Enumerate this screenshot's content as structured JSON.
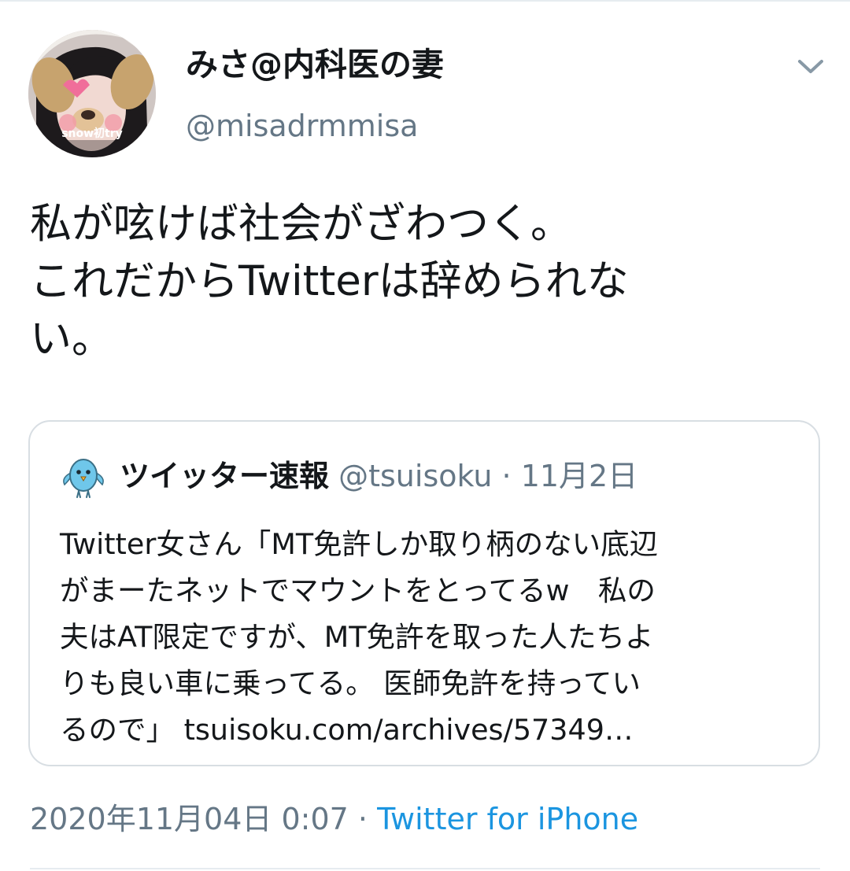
{
  "tweet": {
    "display_name": "みさ@内科医の妻",
    "handle": "@misadrmmisa",
    "avatar_icon": "user-avatar-photo",
    "avatar_caption": "snow初try",
    "text_lines": [
      "私が呟けば社会がざわつく。",
      "これだからTwitterは辞められな",
      "い。"
    ],
    "menu_icon": "chevron-down-icon",
    "timestamp": "2020年11月04日 0:07",
    "separator": "·",
    "source": "Twitter for iPhone"
  },
  "quote": {
    "avatar_icon": "bird-mascot-icon",
    "display_name": "ツイッター速報",
    "handle": "@tsuisoku",
    "separator": "·",
    "date": "11月2日",
    "text_lines": [
      "Twitter女さん「MT免許しか取り柄のない底辺",
      "がまーたネットでマウントをとってるw　私の",
      "夫はAT限定ですが、MT免許を取った人たちよ",
      "りも良い車に乗ってる。 医師免許を持ってい",
      "るので」 tsuisoku.com/archives/57349…"
    ]
  },
  "colors": {
    "text_primary": "#14171a",
    "text_secondary": "#657786",
    "link": "#1b95e0",
    "border": "#d8dee3"
  }
}
